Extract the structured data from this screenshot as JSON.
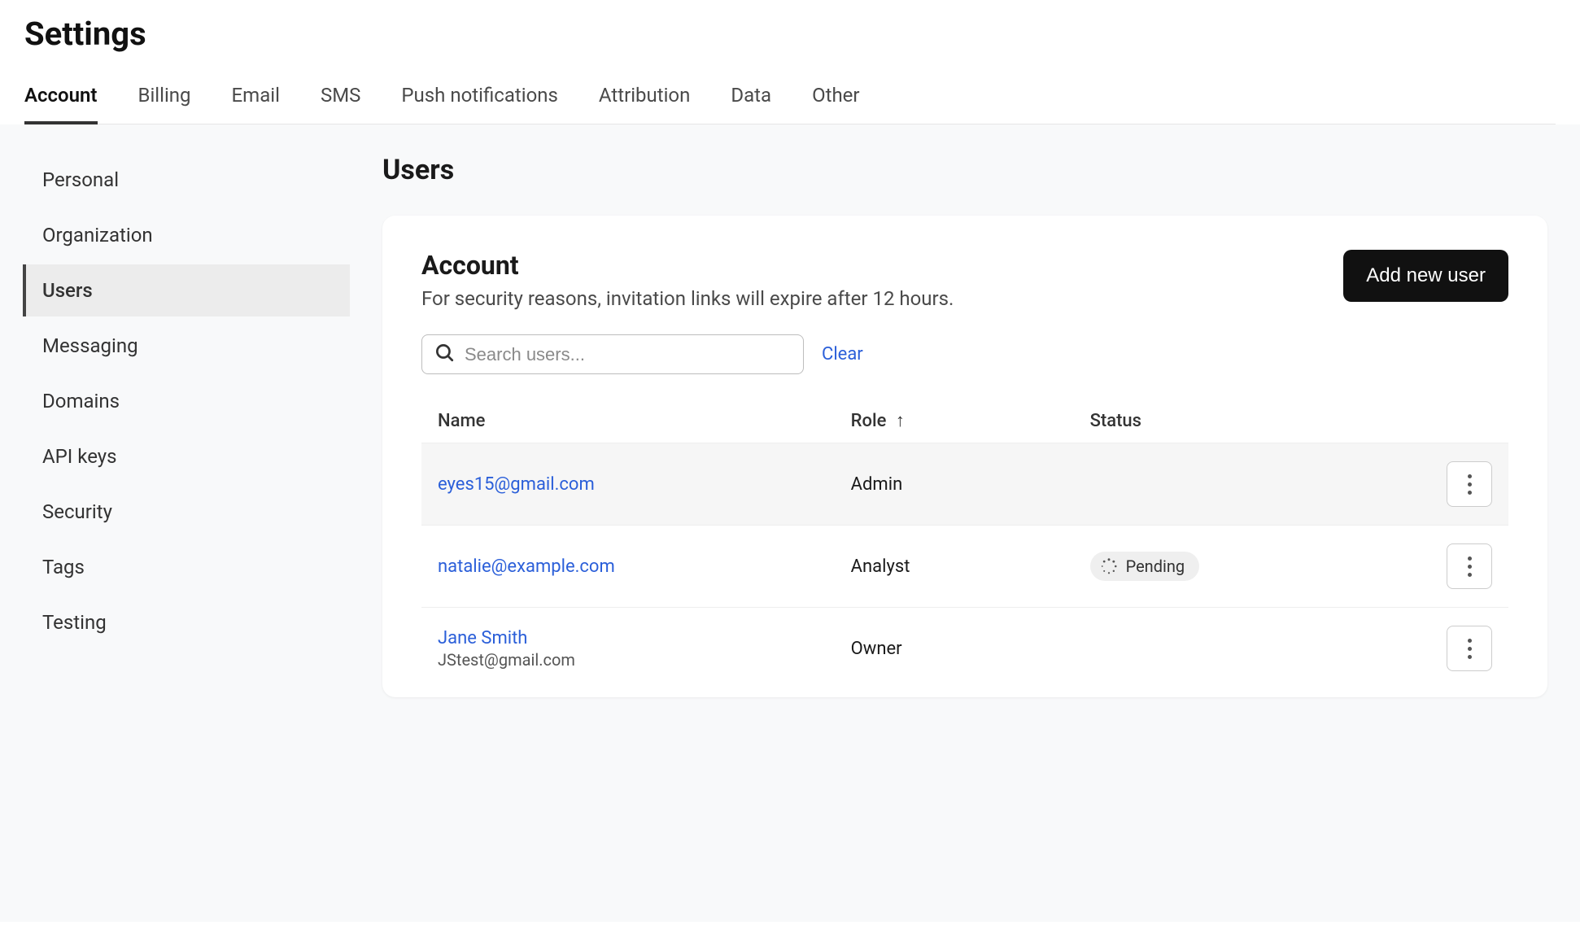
{
  "page_title": "Settings",
  "tabs": [
    {
      "label": "Account",
      "active": true
    },
    {
      "label": "Billing"
    },
    {
      "label": "Email"
    },
    {
      "label": "SMS"
    },
    {
      "label": "Push notifications"
    },
    {
      "label": "Attribution"
    },
    {
      "label": "Data"
    },
    {
      "label": "Other"
    }
  ],
  "sidebar": {
    "items": [
      {
        "label": "Personal"
      },
      {
        "label": "Organization"
      },
      {
        "label": "Users",
        "active": true
      },
      {
        "label": "Messaging"
      },
      {
        "label": "Domains"
      },
      {
        "label": "API keys"
      },
      {
        "label": "Security"
      },
      {
        "label": "Tags"
      },
      {
        "label": "Testing"
      }
    ]
  },
  "main": {
    "section_title": "Users",
    "card": {
      "title": "Account",
      "subtitle": "For security reasons, invitation links will expire after 12 hours.",
      "add_button": "Add new user",
      "search_placeholder": "Search users...",
      "clear_label": "Clear",
      "columns": {
        "name": "Name",
        "role": "Role",
        "sort_arrow": "↑",
        "status": "Status"
      },
      "rows": [
        {
          "name": "eyes15@gmail.com",
          "email": "",
          "role": "Admin",
          "status": ""
        },
        {
          "name": "natalie@example.com",
          "email": "",
          "role": "Analyst",
          "status": "Pending"
        },
        {
          "name": "Jane Smith",
          "email": "JStest@gmail.com",
          "role": "Owner",
          "status": ""
        }
      ]
    }
  }
}
